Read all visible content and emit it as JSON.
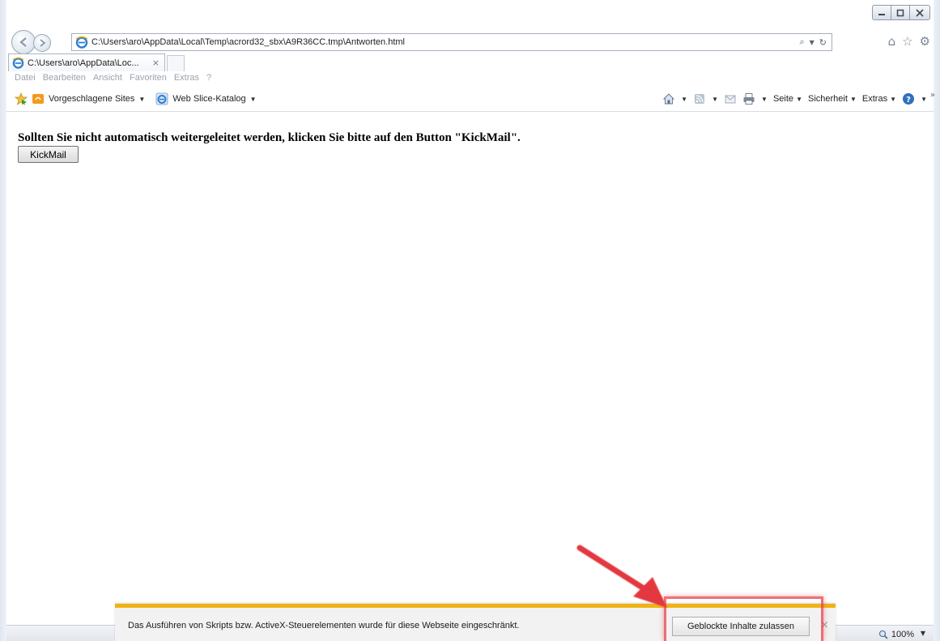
{
  "address_bar": {
    "url": "C:\\Users\\aro\\AppData\\Local\\Temp\\acrord32_sbx\\A9R36CC.tmp\\Antworten.html",
    "search_symbol": "⌕",
    "refresh_symbol": "↻"
  },
  "tab": {
    "title": "C:\\Users\\aro\\AppData\\Loc...",
    "close_symbol": "×"
  },
  "menu": {
    "items": [
      "Datei",
      "Bearbeiten",
      "Ansicht",
      "Favoriten",
      "Extras",
      "?"
    ]
  },
  "favorites_bar": {
    "suggested_sites": "Vorgeschlagene Sites",
    "web_slice": "Web Slice-Katalog"
  },
  "command_bar": {
    "page": "Seite",
    "safety": "Sicherheit",
    "tools": "Extras"
  },
  "page": {
    "message": "Sollten Sie nicht automatisch weitergeleitet werden, klicken Sie bitte auf den Button \"KickMail\".",
    "button_label": "KickMail"
  },
  "notification": {
    "text": "Das Ausführen von Skripts bzw. ActiveX-Steuerelementen wurde für diese Webseite eingeschränkt.",
    "allow_button": "Geblockte Inhalte zulassen",
    "close_symbol": "×"
  },
  "status_bar": {
    "zoom": "100%"
  },
  "colors": {
    "notification_accent": "#f0b316",
    "annotation_red": "#e84048"
  },
  "icons": [
    "back-icon",
    "forward-icon",
    "ie-logo-icon",
    "search-icon",
    "refresh-icon",
    "home-icon",
    "favorites-star-icon",
    "settings-gear-icon",
    "feeds-icon",
    "mail-icon",
    "print-icon",
    "help-icon",
    "zoom-icon",
    "close-icon"
  ]
}
